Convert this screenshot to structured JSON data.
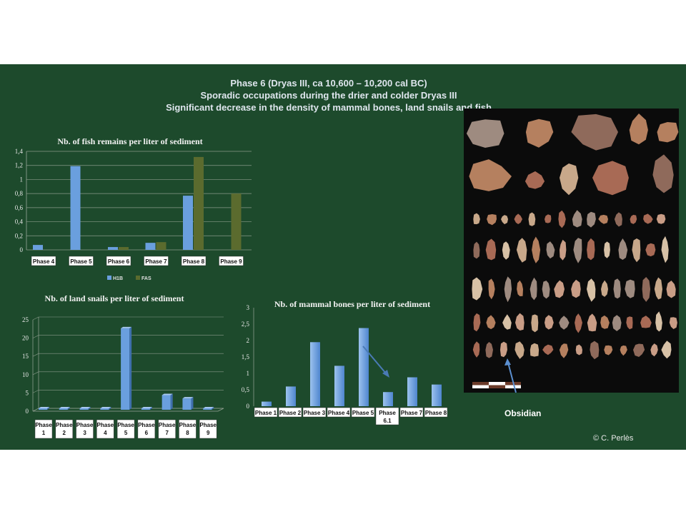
{
  "header": {
    "line1": "Phase 6 (Dryas III, ca 10,600 – 10,200 cal BC)",
    "line2": "Sporadic occupations during the drier and colder Dryas III",
    "line3": "Significant decrease in the density of mammal bones, land snails and fish"
  },
  "photo": {
    "label": "Obsidian",
    "credit": "© C. Perlès"
  },
  "colors": {
    "background": "#1d4a2c",
    "blue": "#6a9fde",
    "olive": "#5b6b2e",
    "text": "#dfe6ee"
  },
  "chart_data": [
    {
      "type": "bar",
      "title": "Nb. of fish remains per liter of sediment",
      "categories": [
        "Phase 4",
        "Phase 5",
        "Phase 6",
        "Phase 7",
        "Phase 8",
        "Phase 9"
      ],
      "series": [
        {
          "name": "H1B",
          "values": [
            0.07,
            1.19,
            0.04,
            0.1,
            0.77,
            0
          ]
        },
        {
          "name": "FAS",
          "values": [
            0,
            0,
            0.04,
            0.11,
            1.32,
            0.8
          ]
        }
      ],
      "yticks": [
        "0",
        "0,2",
        "0,4",
        "0,6",
        "0,8",
        "1",
        "1,2",
        "1,4"
      ],
      "ylim": [
        0,
        1.4
      ],
      "grid": true,
      "legend": "bottom"
    },
    {
      "type": "bar",
      "title": "Nb. of land snails per liter of sediment",
      "categories": [
        [
          "Phase",
          "1"
        ],
        [
          "Phase",
          "2"
        ],
        [
          "Phase",
          "3"
        ],
        [
          "Phase",
          "4"
        ],
        [
          "Phase",
          "5"
        ],
        [
          "Phase",
          "6"
        ],
        [
          "Phase",
          "7"
        ],
        [
          "Phase",
          "8"
        ],
        [
          "Phase",
          "9"
        ]
      ],
      "values": [
        0.3,
        0.2,
        0.3,
        0.3,
        22.3,
        0.3,
        4,
        3.1,
        0.4
      ],
      "yticks": [
        "0",
        "5",
        "10",
        "15",
        "20",
        "25"
      ],
      "ylim": [
        0,
        25
      ],
      "grid": true
    },
    {
      "type": "bar",
      "title": "Nb. of  mammal bones per liter of sediment",
      "categories": [
        [
          "Phase 1"
        ],
        [
          "Phase 2"
        ],
        [
          "Phase 3"
        ],
        [
          "Phase 4"
        ],
        [
          "Phase 5"
        ],
        [
          "Phase",
          "6.1"
        ],
        [
          "Phase 7"
        ],
        [
          "Phase 8"
        ]
      ],
      "values": [
        0.14,
        0.6,
        1.95,
        1.23,
        2.38,
        0.43,
        0.88,
        0.66
      ],
      "yticks": [
        "0",
        "0,5",
        "1",
        "1,5",
        "2",
        "2,5",
        "3"
      ],
      "ylim": [
        0,
        3
      ],
      "grid": false
    }
  ]
}
